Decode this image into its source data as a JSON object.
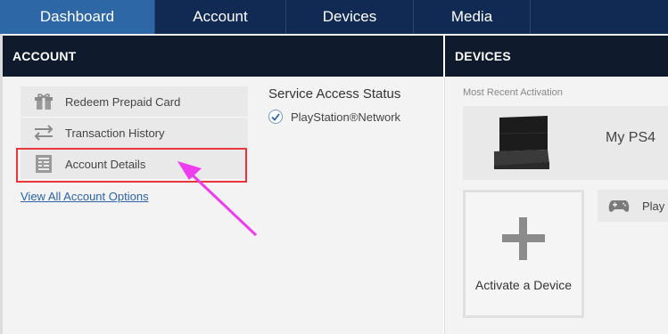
{
  "nav": {
    "tabs": [
      {
        "label": "Dashboard",
        "active": true
      },
      {
        "label": "Account",
        "active": false
      },
      {
        "label": "Devices",
        "active": false
      },
      {
        "label": "Media",
        "active": false
      }
    ]
  },
  "account": {
    "header": "ACCOUNT",
    "menu": [
      {
        "label": "Redeem Prepaid Card",
        "icon": "gift-icon"
      },
      {
        "label": "Transaction History",
        "icon": "transfer-arrows-icon"
      },
      {
        "label": "Account Details",
        "icon": "document-icon"
      }
    ],
    "view_all": "View All Account Options"
  },
  "service": {
    "title": "Service Access Status",
    "items": [
      {
        "label": "PlayStation®Network",
        "status": "checked"
      }
    ]
  },
  "devices": {
    "header": "DEVICES",
    "most_recent_label": "Most Recent Activation",
    "recent_device_name": "My PS4",
    "activate_label": "Activate a Device",
    "play_item_label": "Play"
  },
  "colors": {
    "nav_bg": "#102a54",
    "nav_active": "#2d67a6",
    "panel_header": "#101a2d",
    "highlight_border": "#e8373b",
    "arrow": "#ee3cef",
    "link": "#2b63a6"
  }
}
